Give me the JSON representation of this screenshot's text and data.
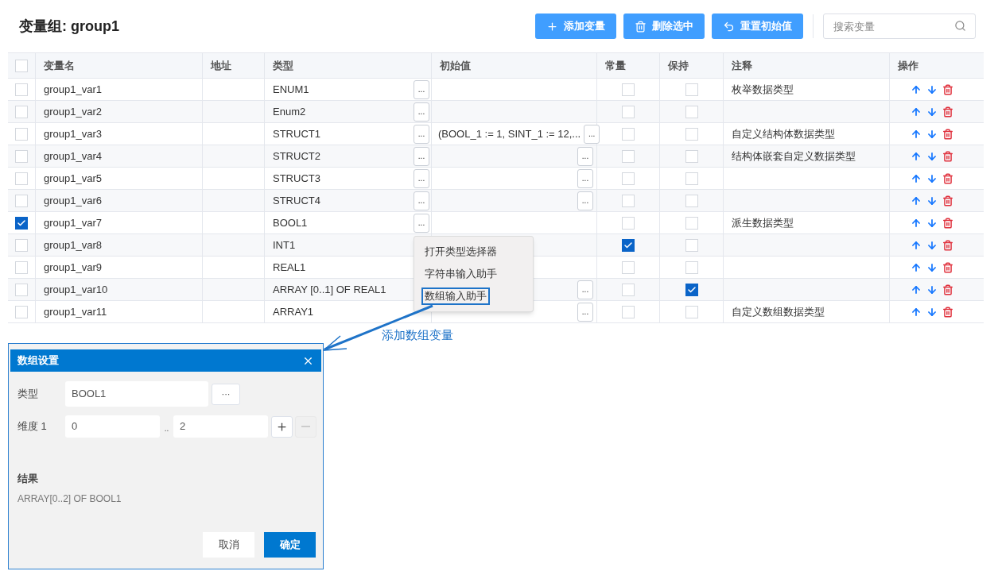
{
  "title": "变量组: group1",
  "toolbar": [
    {
      "kind": "add",
      "label": "添加变量"
    },
    {
      "kind": "delete",
      "label": "删除选中"
    },
    {
      "kind": "reset",
      "label": "重置初始值"
    }
  ],
  "search": {
    "placeholder": "搜索变量"
  },
  "table": {
    "all_checked": false,
    "columns": [
      "变量名",
      "地址",
      "类型",
      "初始值",
      "常量",
      "保持",
      "注释",
      "操作"
    ],
    "rows": [
      {
        "checked": false,
        "name": "group1_var1",
        "type": "ENUM1",
        "type_button": "...",
        "constant": false,
        "retain": false,
        "comment": "枚举数据类型"
      },
      {
        "checked": false,
        "name": "group1_var2",
        "type": "Enum2",
        "type_button": "...",
        "constant": false,
        "retain": false
      },
      {
        "checked": false,
        "name": "group1_var3",
        "type": "STRUCT1",
        "type_button": "...",
        "init_value": "(BOOL_1 := 1, SINT_1 := 12,...",
        "init_button": "...",
        "constant": false,
        "retain": false,
        "comment": "自定义结构体数据类型"
      },
      {
        "checked": false,
        "name": "group1_var4",
        "type": "STRUCT2",
        "type_button": "...",
        "init_button": "...",
        "constant": false,
        "retain": false,
        "comment": "结构体嵌套自定义数据类型"
      },
      {
        "checked": false,
        "name": "group1_var5",
        "type": "STRUCT3",
        "type_button": "...",
        "init_button": "...",
        "constant": false,
        "retain": false
      },
      {
        "checked": false,
        "name": "group1_var6",
        "type": "STRUCT4",
        "type_button": "...",
        "init_button": "...",
        "constant": false,
        "retain": false
      },
      {
        "checked": true,
        "name": "group1_var7",
        "type": "BOOL1",
        "type_button": "...",
        "constant": false,
        "retain": false,
        "comment": "派生数据类型"
      },
      {
        "checked": false,
        "name": "group1_var8",
        "type": "INT1",
        "constant": true,
        "retain": false
      },
      {
        "checked": false,
        "name": "group1_var9",
        "type": "REAL1",
        "constant": false,
        "retain": false
      },
      {
        "checked": false,
        "name": "group1_var10",
        "type": "ARRAY [0..1] OF REAL1",
        "init_button": "...",
        "constant": false,
        "retain": true
      },
      {
        "checked": false,
        "name": "group1_var11",
        "type": "ARRAY1",
        "init_button": "...",
        "constant": false,
        "retain": false,
        "comment": "自定义数组数据类型"
      }
    ]
  },
  "context_menu": [
    {
      "label": "打开类型选择器",
      "highlighted": false
    },
    {
      "label": "字符串输入助手",
      "highlighted": false
    },
    {
      "label": "数组输入助手",
      "highlighted": true
    }
  ],
  "annotation": {
    "text": "添加数组变量"
  },
  "dialog": {
    "title": "数组设置",
    "type_label": "类型",
    "type_value": "BOOL1",
    "type_button": "···",
    "dimension_label": "维度 1",
    "lower": "0",
    "range_separator": "..",
    "upper": "2",
    "remove_disabled": true,
    "result_label": "结果",
    "result_value": "ARRAY[0..2] OF BOOL1",
    "cancel": "取消",
    "ok": "确定"
  }
}
